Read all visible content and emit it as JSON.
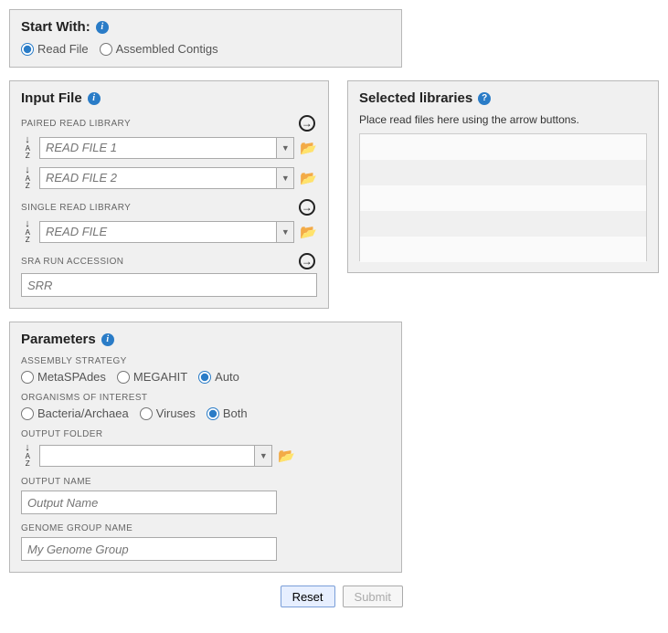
{
  "start": {
    "title": "Start With:",
    "opt_read_file": "Read File",
    "opt_assembled": "Assembled Contigs"
  },
  "input": {
    "title": "Input File",
    "paired_label": "PAIRED READ LIBRARY",
    "read_file_1_ph": "READ FILE 1",
    "read_file_2_ph": "READ FILE 2",
    "single_label": "SINGLE READ LIBRARY",
    "single_ph": "READ FILE",
    "sra_label": "SRA RUN ACCESSION",
    "sra_ph": "SRR"
  },
  "selected": {
    "title": "Selected libraries",
    "hint": "Place read files here using the arrow buttons."
  },
  "params": {
    "title": "Parameters",
    "strategy_label": "ASSEMBLY STRATEGY",
    "strategy_meta": "MetaSPAdes",
    "strategy_mega": "MEGAHIT",
    "strategy_auto": "Auto",
    "org_label": "ORGANISMS OF INTEREST",
    "org_bact": "Bacteria/Archaea",
    "org_vir": "Viruses",
    "org_both": "Both",
    "outfolder_label": "OUTPUT FOLDER",
    "outname_label": "OUTPUT NAME",
    "outname_ph": "Output Name",
    "ggroup_label": "GENOME GROUP NAME",
    "ggroup_ph": "My Genome Group"
  },
  "buttons": {
    "reset": "Reset",
    "submit": "Submit"
  }
}
